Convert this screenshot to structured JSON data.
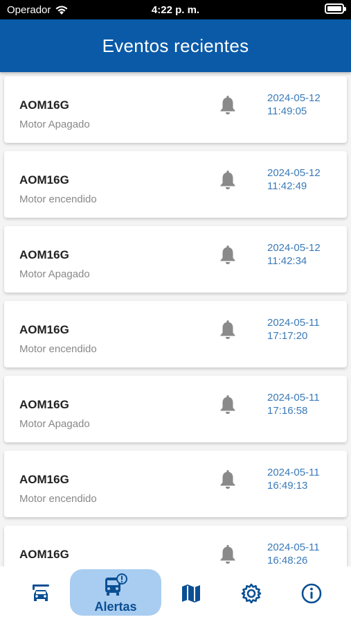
{
  "status_bar": {
    "carrier": "Operador",
    "time": "4:22 p. m."
  },
  "header": {
    "title": "Eventos recientes"
  },
  "events": [
    {
      "plate": "AOM16G",
      "description": "Motor Apagado",
      "date": "2024-05-12",
      "time": "11:49:05"
    },
    {
      "plate": "AOM16G",
      "description": "Motor encendido",
      "date": "2024-05-12",
      "time": "11:42:49"
    },
    {
      "plate": "AOM16G",
      "description": "Motor Apagado",
      "date": "2024-05-12",
      "time": "11:42:34"
    },
    {
      "plate": "AOM16G",
      "description": "Motor encendido",
      "date": "2024-05-11",
      "time": "17:17:20"
    },
    {
      "plate": "AOM16G",
      "description": "Motor Apagado",
      "date": "2024-05-11",
      "time": "17:16:58"
    },
    {
      "plate": "AOM16G",
      "description": "Motor encendido",
      "date": "2024-05-11",
      "time": "16:49:13"
    },
    {
      "plate": "AOM16G",
      "description": "",
      "date": "2024-05-11",
      "time": "16:48:26"
    }
  ],
  "nav": {
    "active_label": "Alertas",
    "items": [
      {
        "icon": "vehicle-icon"
      },
      {
        "icon": "bus-alert-icon"
      },
      {
        "icon": "map-icon"
      },
      {
        "icon": "gear-icon"
      },
      {
        "icon": "info-icon"
      }
    ]
  },
  "colors": {
    "header": "#0a5aa8",
    "accent_text": "#3a7ab8",
    "nav_active": "#a9cdf0",
    "nav_icon": "#0a4f94",
    "bell": "#8a8a8a"
  }
}
